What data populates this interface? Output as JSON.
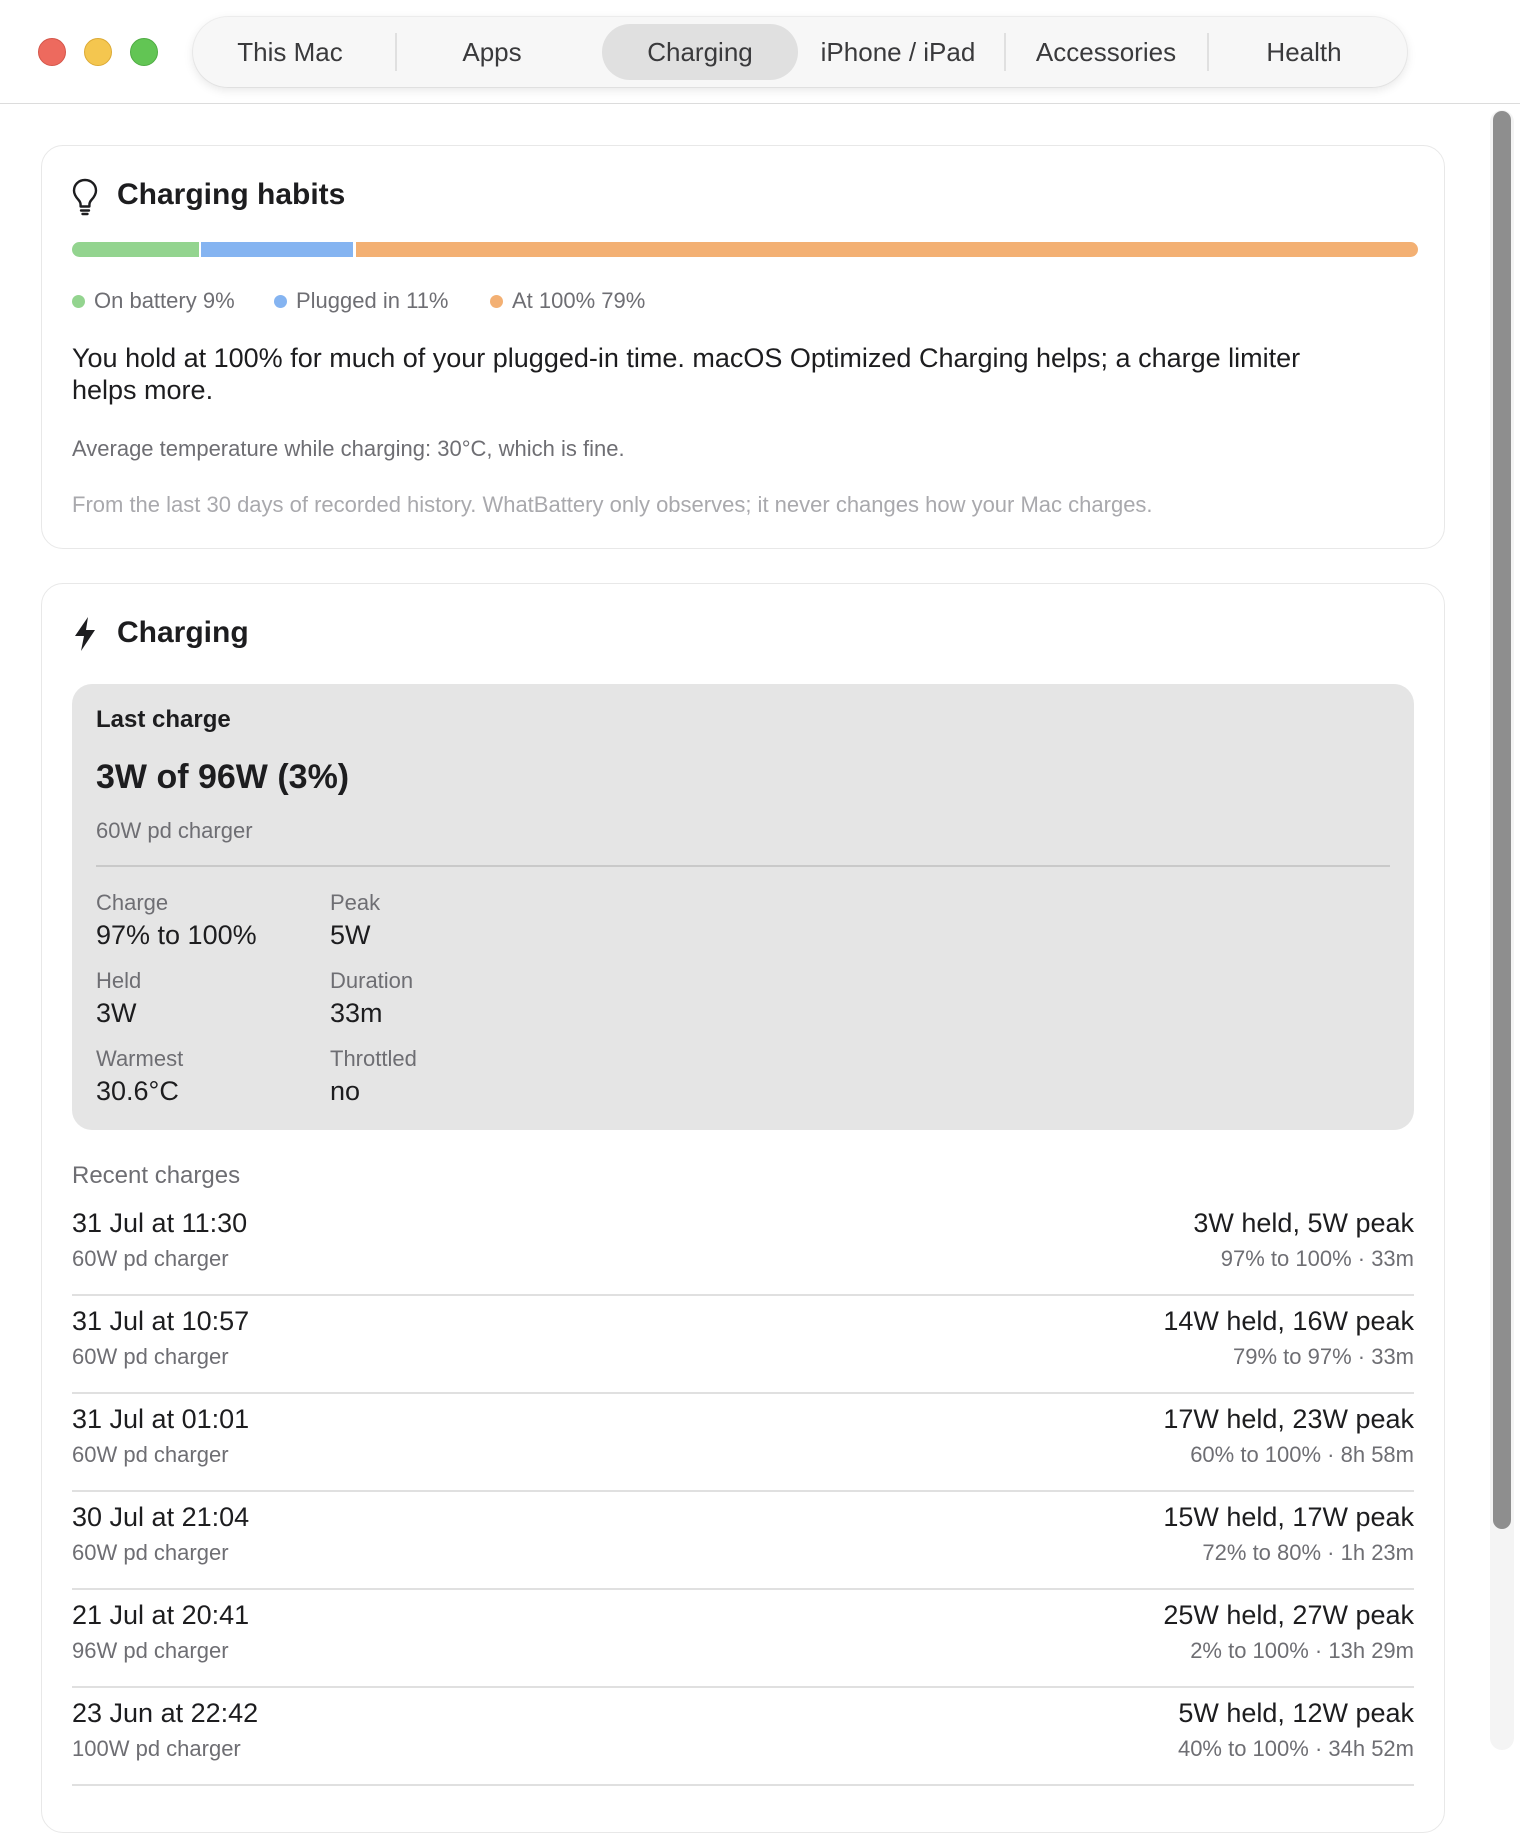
{
  "window": {
    "tabs": [
      {
        "label": "This Mac",
        "active": false
      },
      {
        "label": "Apps",
        "active": false
      },
      {
        "label": "Charging",
        "active": true
      },
      {
        "label": "iPhone / iPad",
        "active": false
      },
      {
        "label": "Accessories",
        "active": false
      },
      {
        "label": "Health",
        "active": false
      }
    ]
  },
  "habits": {
    "title": "Charging habits",
    "icon": "lightbulb-icon",
    "segments": [
      {
        "label": "On battery 9%",
        "color": "#93d48f"
      },
      {
        "label": "Plugged in 11%",
        "color": "#85b4f1"
      },
      {
        "label": "At 100% 79%",
        "color": "#f3b073"
      }
    ],
    "message": "You hold at 100% for much of your plugged-in time. macOS Optimized Charging helps; a charge limiter helps more.",
    "temperature_note": "Average temperature while charging: 30°C, which is fine.",
    "footnote": "From the last 30 days of recorded history. WhatBattery only observes; it never changes how your Mac charges."
  },
  "charging": {
    "title": "Charging",
    "icon": "bolt-icon",
    "last_charge": {
      "label": "Last charge",
      "value": "3W of 96W (3%)",
      "charger": "60W pd charger",
      "stats": [
        {
          "label": "Charge",
          "value": "97% to 100%"
        },
        {
          "label": "Peak",
          "value": "5W"
        },
        {
          "label": "Held",
          "value": "3W"
        },
        {
          "label": "Duration",
          "value": "33m"
        },
        {
          "label": "Warmest",
          "value": "30.6°C"
        },
        {
          "label": "Throttled",
          "value": "no"
        }
      ]
    },
    "recent_title": "Recent charges",
    "recent": [
      {
        "date": "31 Jul at 11:30",
        "charger": "60W pd charger",
        "power": "3W held, 5W peak",
        "range": "97% to 100% · 33m"
      },
      {
        "date": "31 Jul at 10:57",
        "charger": "60W pd charger",
        "power": "14W held, 16W peak",
        "range": "79% to 97% · 33m"
      },
      {
        "date": "31 Jul at 01:01",
        "charger": "60W pd charger",
        "power": "17W held, 23W peak",
        "range": "60% to 100% · 8h 58m"
      },
      {
        "date": "30 Jul at 21:04",
        "charger": "60W pd charger",
        "power": "15W held, 17W peak",
        "range": "72% to 80% · 1h 23m"
      },
      {
        "date": "21 Jul at 20:41",
        "charger": "96W pd charger",
        "power": "25W held, 27W peak",
        "range": "2% to 100% · 13h 29m"
      },
      {
        "date": "23 Jun at 22:42",
        "charger": "100W pd charger",
        "power": "5W held, 12W peak",
        "range": "40% to 100% · 34h 52m"
      }
    ]
  }
}
